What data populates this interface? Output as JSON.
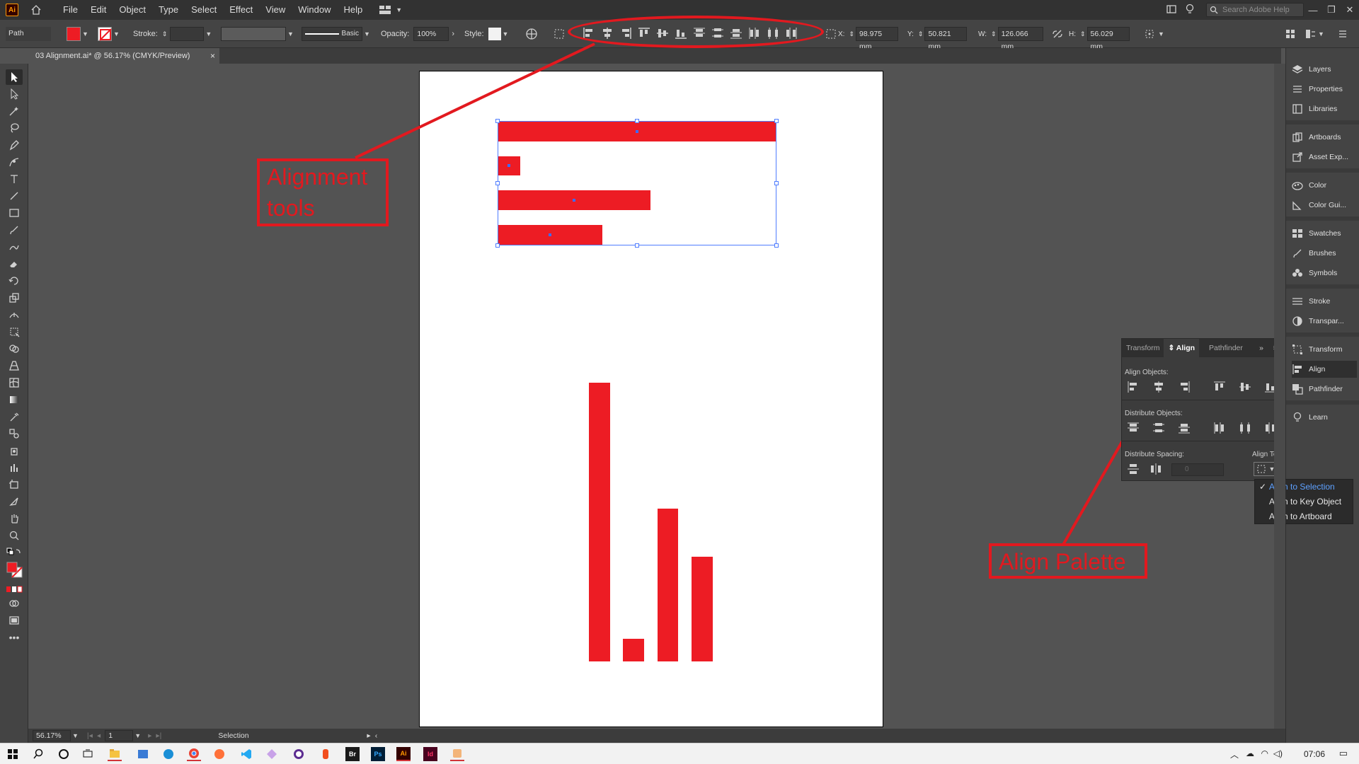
{
  "app": {
    "logo": "Ai"
  },
  "menu": [
    "File",
    "Edit",
    "Object",
    "Type",
    "Select",
    "Effect",
    "View",
    "Window",
    "Help"
  ],
  "search": {
    "placeholder": "Search Adobe Help"
  },
  "control": {
    "object_type": "Path",
    "stroke_label": "Stroke:",
    "brush_label": "Basic",
    "opacity_label": "Opacity:",
    "opacity_value": "100%",
    "style_label": "Style:",
    "x_label": "X:",
    "x_value": "98.975 mm",
    "y_label": "Y:",
    "y_value": "50.821 mm",
    "w_label": "W:",
    "w_value": "126.066 mm",
    "h_label": "H:",
    "h_value": "56.029 mm",
    "fill_color": "#ed1c24"
  },
  "document": {
    "tab_title": "03 Alignment.ai* @ 56.17% (CMYK/Preview)",
    "close": "×"
  },
  "callouts": {
    "alignment_tools": "Alignment tools",
    "align_palette": "Align Palette"
  },
  "dock": {
    "items": [
      "Layers",
      "Properties",
      "Libraries",
      "Artboards",
      "Asset Exp...",
      "Color",
      "Color Gui...",
      "Swatches",
      "Brushes",
      "Symbols",
      "Stroke",
      "Transpar...",
      "Transform",
      "Align",
      "Pathfinder",
      "Learn"
    ]
  },
  "align_panel": {
    "tabs": [
      "Transform",
      "Align",
      "Pathfinder"
    ],
    "align_objects": "Align Objects:",
    "distribute_objects": "Distribute Objects:",
    "distribute_spacing": "Distribute Spacing:",
    "align_to": "Align To:",
    "spacing_value": "0",
    "menu": [
      "Align to Selection",
      "Align to Key Object",
      "Align to Artboard"
    ]
  },
  "status": {
    "zoom": "56.17%",
    "page": "1",
    "mode": "Selection"
  },
  "taskbar": {
    "time": "07:06"
  }
}
